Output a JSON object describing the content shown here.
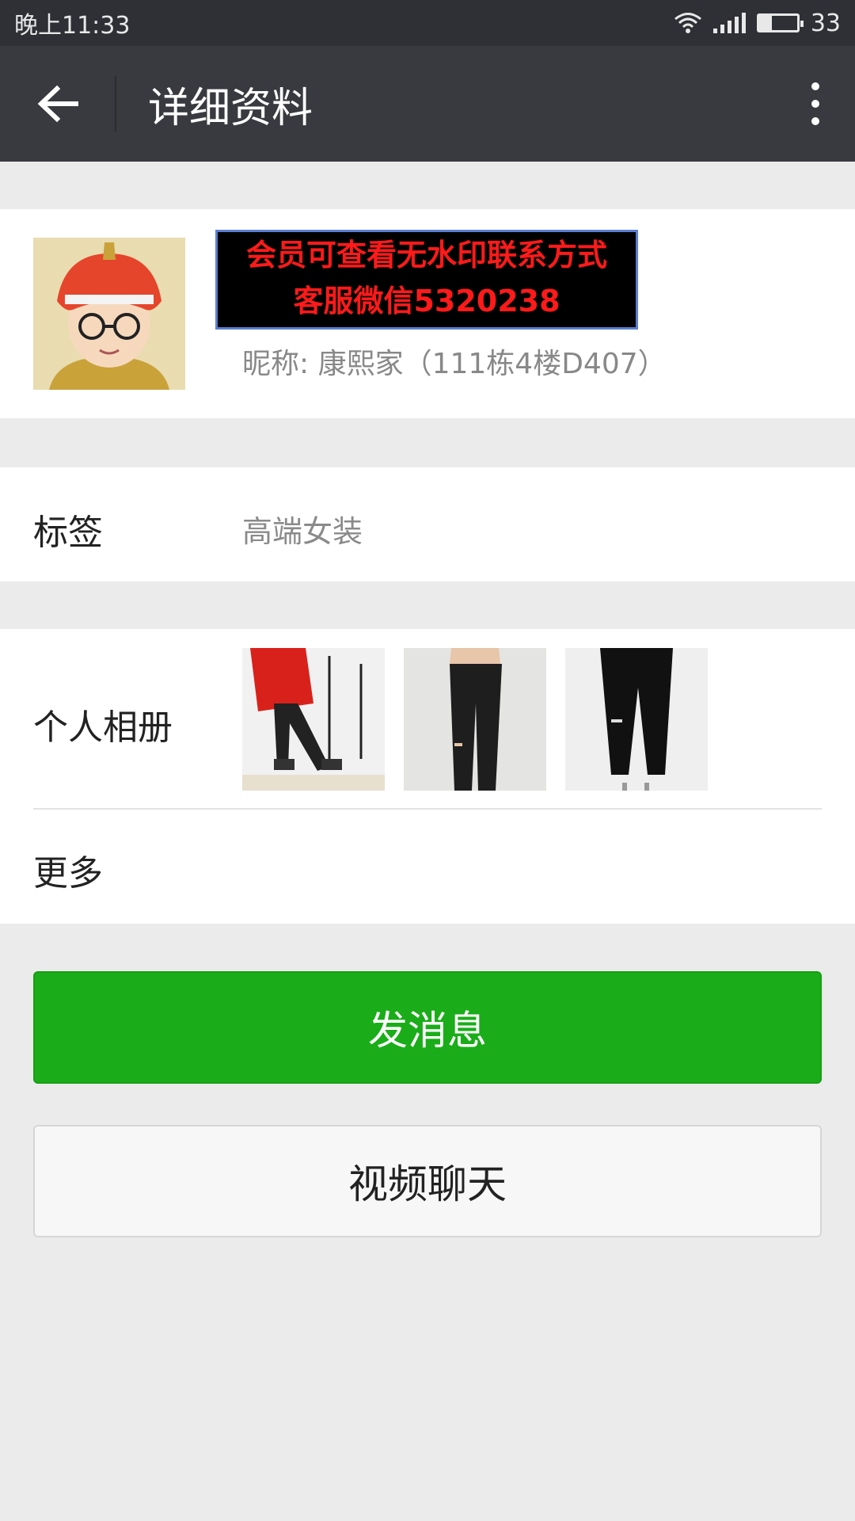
{
  "status_bar": {
    "time": "晚上11:33",
    "battery": "33"
  },
  "header": {
    "title": "详细资料"
  },
  "profile": {
    "watermark_line1": "会员可查看无水印联系方式",
    "watermark_line2": "客服微信5320238",
    "nickname": "昵称: 康熙家（111栋4楼D407）"
  },
  "tags": {
    "label": "标签",
    "value": "高端女装"
  },
  "album": {
    "label": "个人相册"
  },
  "more": {
    "label": "更多"
  },
  "actions": {
    "send_message": "发消息",
    "video_chat": "视频聊天"
  },
  "colors": {
    "header_bg": "#393a3f",
    "primary_button": "#1aad19",
    "page_bg": "#ebebeb"
  }
}
